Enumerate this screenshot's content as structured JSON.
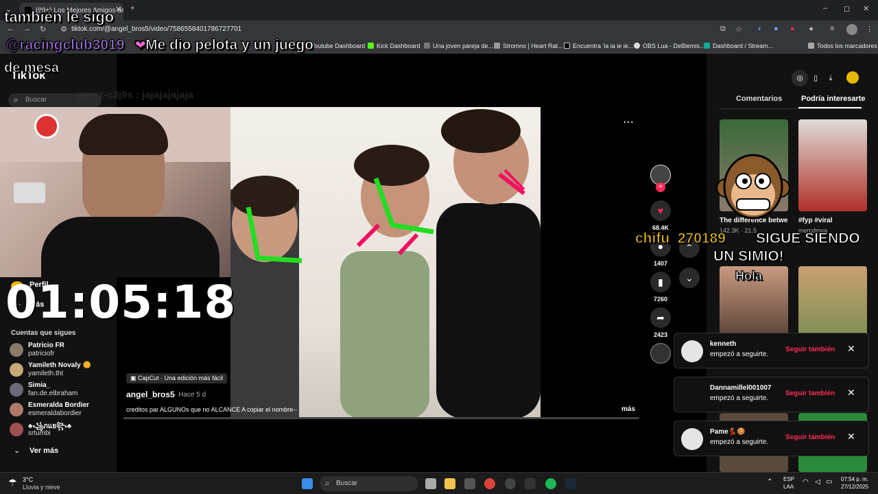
{
  "browser": {
    "tab_title": "(99+) Los Mejores Amigos de A",
    "url": "tiktok.com/@angel_bros5/video/7586558401786727701",
    "bookmarks": [
      "Youtube Dashboard",
      "Kick Dashboard",
      "Una joven pareja de...",
      "Stromno | Heart Rat...",
      "Encuentra 'ia ia ie ie...",
      "OBS Lua - DeBlemis...",
      "Dashboard / Stream...",
      "Todos los marcadores"
    ]
  },
  "tiktok": {
    "logo": "TikTok",
    "search_placeholder": "Buscar",
    "profile_label": "Perfil",
    "more_label": "Más",
    "following_title": "Cuentas que sigues",
    "following": [
      {
        "name": "Patricio FR",
        "handle": "patriciofr",
        "color": "#8a7a6a"
      },
      {
        "name": "Yamileth Novaly 🌼",
        "handle": "yamileth.tht",
        "color": "#c9a97a"
      },
      {
        "name": "Simia_",
        "handle": "fan.de.elbraham",
        "color": "#6a6a7a"
      },
      {
        "name": "Esmeralda Bordier",
        "handle": "esmeraldabordier",
        "color": "#b07a6a"
      },
      {
        "name": "♣꧁ภแย꧂♣",
        "handle": "srtumbi",
        "color": "#a05050"
      }
    ],
    "see_more": "Ver más",
    "video": {
      "capcut_label": "CapCut · Una edición más fácil",
      "author": "angel_bros5",
      "time_ago": "· Hace 5 d",
      "caption": "creditos par ALGUNOs que no ALCANCE A copiar el nombre--",
      "more": "más"
    },
    "actions": {
      "likes": "68.4K",
      "comments": "1407",
      "saves": "7260",
      "shares": "2423"
    },
    "tabs": {
      "comments": "Comentarios",
      "recommended": "Podría interesarte"
    },
    "recommended": [
      {
        "caption": "The difference between weighte",
        "stats": "142.3K · 21.5"
      },
      {
        "caption": "#fyp #viral",
        "stats": "mercdmya"
      }
    ],
    "notifications": [
      {
        "name": "kenneth",
        "text": "empezó a seguirte.",
        "button": "Seguir también"
      },
      {
        "name": "Dannamillel001007",
        "text": "empezó a seguirte.",
        "button": "Seguir también"
      },
      {
        "name": "Pame💃🍪",
        "text": "empezó a seguirte.",
        "button": "Seguir también"
      }
    ]
  },
  "stream_overlay": {
    "line1": "también le sigo",
    "user": "@racingclub3019",
    "message": "Me dio pelota y un juego",
    "line3": "de mesa",
    "faded_chat": "perez-c3j9s : jajajajajaja",
    "timer": "01:05:18",
    "alert_user": "chifu_270189",
    "alert_text_1": "SIGUE SIENDO",
    "alert_text_2": "UN SIMIO!",
    "hola": "Hola"
  },
  "taskbar": {
    "weather_temp": "3°C",
    "weather_desc": "Lluvia y nieve",
    "search": "Buscar",
    "lang": "ESP",
    "lang2": "LAA",
    "time": "07:54 p. m.",
    "date": "27/12/2025"
  }
}
